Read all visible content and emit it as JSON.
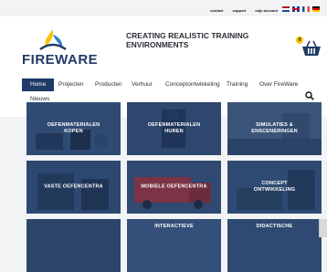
{
  "topbar": {
    "links": [
      "contact",
      "support",
      "mijn account"
    ],
    "languages": [
      "nl",
      "en",
      "fr",
      "de"
    ]
  },
  "brand": {
    "logo_text": "FIREWARE",
    "tagline_line1": "CREATING REALISTIC TRAINING",
    "tagline_line2": "ENVIRONMENTS",
    "accent_blue": "#1f3a66",
    "accent_yellow": "#f5c400"
  },
  "cart": {
    "count": "0"
  },
  "nav": {
    "items": [
      "Home",
      "Projecten",
      "Producten",
      "Verhuur",
      "Conceptontwikkeling",
      "Training",
      "Over FireWare",
      "Nieuws"
    ],
    "active": "Home"
  },
  "tiles": [
    {
      "label1": "OEFENMATERIALEN",
      "label2": "KOPEN"
    },
    {
      "label1": "OEFENMATERIALEN",
      "label2": "HUREN"
    },
    {
      "label1": "SIMULATIES &",
      "label2": "ENSCENERINGEN"
    },
    {
      "label1": "VASTE OEFENCENTRA",
      "label2": ""
    },
    {
      "label1": "MOBIELE OEFENCENTRA",
      "label2": ""
    },
    {
      "label1": "CONCEPT",
      "label2": "ONTWIKKELING"
    },
    {
      "label1": "",
      "label2": ""
    },
    {
      "label1": "INTERACTIEVE",
      "label2": ""
    },
    {
      "label1": "DIDACTISCHE",
      "label2": ""
    }
  ]
}
